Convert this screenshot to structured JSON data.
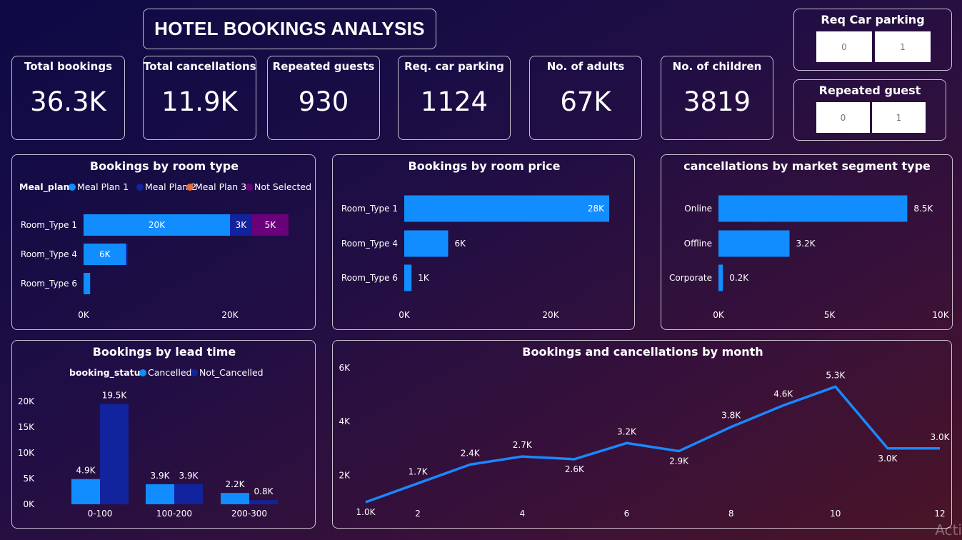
{
  "title": "HOTEL BOOKINGS ANALYSIS",
  "kpis": [
    {
      "label": "Total bookings",
      "value": "36.3K"
    },
    {
      "label": "Total cancellations",
      "value": "11.9K"
    },
    {
      "label": "Repeated guests",
      "value": "930"
    },
    {
      "label": "Req. car parking",
      "value": "1124"
    },
    {
      "label": "No. of adults",
      "value": "67K"
    },
    {
      "label": "No. of children",
      "value": "3819"
    }
  ],
  "slicers": [
    {
      "title": "Req Car parking",
      "options": [
        "0",
        "1"
      ]
    },
    {
      "title": "Repeated guest",
      "options": [
        "0",
        "1"
      ]
    }
  ],
  "colors": {
    "light_blue": "#118dff",
    "navy": "#12239e",
    "orange": "#e66c37",
    "purple": "#6b007b",
    "line": "#1a88ff"
  },
  "watermark": "Acti",
  "chart_data": [
    {
      "type": "bar",
      "orientation": "horizontal",
      "stacked": true,
      "title": "Bookings by room type",
      "legend_title": "Meal_plan",
      "legend_position": "top-left",
      "categories": [
        "Room_Type 1",
        "Room_Type 4",
        "Room_Type 6"
      ],
      "series": [
        {
          "name": "Meal Plan 1",
          "color": "#118dff",
          "values": [
            20000,
            5800,
            900
          ],
          "labels": [
            "20K",
            "6K",
            ""
          ]
        },
        {
          "name": "Meal Plan 2",
          "color": "#12239e",
          "values": [
            3000,
            200,
            0
          ],
          "labels": [
            "3K",
            "",
            ""
          ]
        },
        {
          "name": "Meal Plan 3",
          "color": "#e66c37",
          "values": [
            0,
            0,
            0
          ],
          "labels": [
            "",
            "",
            ""
          ]
        },
        {
          "name": "Not Selected",
          "color": "#6b007b",
          "values": [
            5000,
            0,
            0
          ],
          "labels": [
            "5K",
            "",
            ""
          ]
        }
      ],
      "xlim": [
        0,
        28000
      ],
      "xticks": [
        {
          "v": 0,
          "label": "0K"
        },
        {
          "v": 20000,
          "label": "20K"
        }
      ]
    },
    {
      "type": "bar",
      "orientation": "horizontal",
      "title": "Bookings by room price",
      "categories": [
        "Room_Type 1",
        "Room_Type 4",
        "Room_Type 6"
      ],
      "values": [
        28000,
        6000,
        1000
      ],
      "labels": [
        "28K",
        "6K",
        "1K"
      ],
      "xlim": [
        0,
        28000
      ],
      "xticks": [
        {
          "v": 0,
          "label": "0K"
        },
        {
          "v": 20000,
          "label": "20K"
        }
      ]
    },
    {
      "type": "bar",
      "orientation": "horizontal",
      "title": "cancellations by market segment type",
      "categories": [
        "Online",
        "Offline",
        "Corporate"
      ],
      "values": [
        8500,
        3200,
        200
      ],
      "labels": [
        "8.5K",
        "3.2K",
        "0.2K"
      ],
      "xlim": [
        0,
        10000
      ],
      "xticks": [
        {
          "v": 0,
          "label": "0K"
        },
        {
          "v": 5000,
          "label": "5K"
        },
        {
          "v": 10000,
          "label": "10K"
        }
      ]
    },
    {
      "type": "bar",
      "orientation": "vertical",
      "title": "Bookings by lead time",
      "legend_title": "booking_status",
      "legend_position": "top-center",
      "categories": [
        "0-100",
        "100-200",
        "200-300"
      ],
      "series": [
        {
          "name": "Cancelled",
          "color": "#118dff",
          "values": [
            4900,
            3900,
            2200
          ],
          "labels": [
            "4.9K",
            "3.9K",
            "2.2K"
          ]
        },
        {
          "name": "Not_Cancelled",
          "color": "#12239e",
          "values": [
            19500,
            3900,
            800
          ],
          "labels": [
            "19.5K",
            "3.9K",
            "0.8K"
          ]
        }
      ],
      "ylim": [
        0,
        20000
      ],
      "yticks": [
        {
          "v": 0,
          "label": "0K"
        },
        {
          "v": 5000,
          "label": "5K"
        },
        {
          "v": 10000,
          "label": "10K"
        },
        {
          "v": 15000,
          "label": "15K"
        },
        {
          "v": 20000,
          "label": "20K"
        }
      ]
    },
    {
      "type": "line",
      "title": "Bookings and cancellations by month",
      "x": [
        1,
        2,
        3,
        4,
        5,
        6,
        7,
        8,
        9,
        10,
        11,
        12
      ],
      "values": [
        1000,
        1700,
        2400,
        2700,
        2600,
        3200,
        2900,
        3800,
        4600,
        5300,
        3000,
        3000
      ],
      "labels": [
        "1.0K",
        "1.7K",
        "2.4K",
        "2.7K",
        "2.6K",
        "3.2K",
        "2.9K",
        "3.8K",
        "4.6K",
        "5.3K",
        "3.0K",
        "3.0K"
      ],
      "ylim": [
        1000,
        6000
      ],
      "yticks": [
        {
          "v": 2000,
          "label": "2K"
        },
        {
          "v": 4000,
          "label": "4K"
        },
        {
          "v": 6000,
          "label": "6K"
        }
      ],
      "xticks": [
        {
          "v": 2,
          "label": "2"
        },
        {
          "v": 4,
          "label": "4"
        },
        {
          "v": 6,
          "label": "6"
        },
        {
          "v": 8,
          "label": "8"
        },
        {
          "v": 10,
          "label": "10"
        },
        {
          "v": 12,
          "label": "12"
        }
      ]
    }
  ]
}
